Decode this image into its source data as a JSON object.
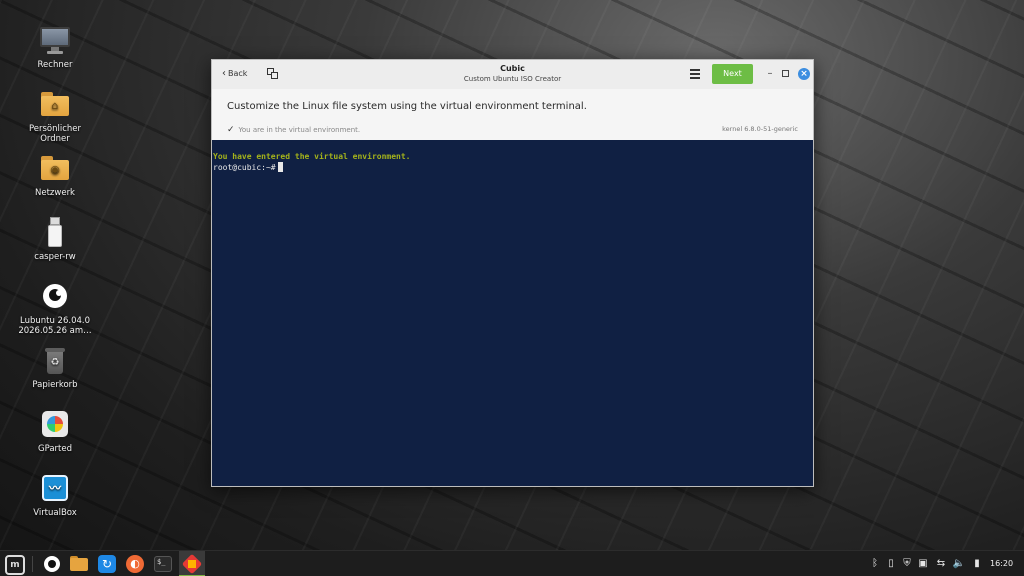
{
  "desktop": {
    "icons": [
      {
        "label": "Rechner"
      },
      {
        "label": "Persönlicher Ordner"
      },
      {
        "label": "Netzwerk"
      },
      {
        "label": "casper-rw"
      },
      {
        "label": "Lubuntu 26.04.0 2026.05.26 am…"
      },
      {
        "label": "Papierkorb"
      },
      {
        "label": "GParted"
      },
      {
        "label": "VirtualBox"
      }
    ]
  },
  "window": {
    "back_label": "Back",
    "title": "Cubic",
    "subtitle": "Custom Ubuntu ISO Creator",
    "next_label": "Next",
    "heading": "Customize the Linux file system using the virtual environment terminal.",
    "status_text": "You are in the virtual environment.",
    "kernel": "kernel 6.8.0-51-generic",
    "terminal": {
      "message": "You have entered the virtual environment.",
      "prompt": "root@cubic:~#"
    }
  },
  "taskbar": {
    "clock": "16:20"
  },
  "colors": {
    "accent_green": "#6dbd45",
    "close_blue": "#3d8ee0",
    "terminal_bg": "#102043",
    "terminal_message": "#a4b31b"
  }
}
